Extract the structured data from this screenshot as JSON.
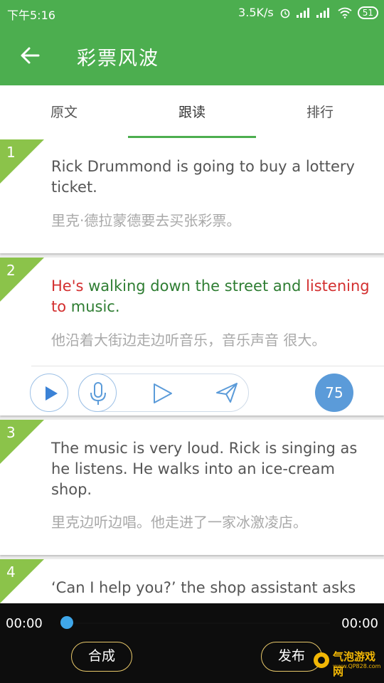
{
  "status": {
    "time": "下午5:16",
    "speed": "3.5K/s",
    "battery": "51"
  },
  "header": {
    "title": "彩票风波"
  },
  "tabs": [
    {
      "label": "原文"
    },
    {
      "label": "跟读"
    },
    {
      "label": "排行"
    }
  ],
  "active_tab": "跟读",
  "sentences": [
    {
      "num": "1",
      "en": "Rick Drummond is going to buy a lottery ticket.",
      "zh": "里克·德拉蒙德要去买张彩票。"
    },
    {
      "num": "2",
      "en_parts": [
        {
          "text": "He's ",
          "tone": "red"
        },
        {
          "text": "walking down the street and ",
          "tone": "green"
        },
        {
          "text": "listening ",
          "tone": "red"
        },
        {
          "text": "to ",
          "tone": "red"
        },
        {
          "text": "music.",
          "tone": "green"
        }
      ],
      "zh": "他沿着大街边走边听音乐，音乐声音 很大。",
      "score": "75"
    },
    {
      "num": "3",
      "en": "The music is very loud. Rick is singing as he listens. He walks into an ice-cream shop.",
      "zh": "里克边听边唱。他走进了一家冰激凌店。"
    },
    {
      "num": "4",
      "en": "‘Can I help you?’ the shop assistant asks"
    }
  ],
  "colors": {
    "primary": "#4cae4f",
    "score": "#5b9bd9",
    "word_good": "#2e7d32",
    "word_bad": "#d32f2f"
  },
  "player": {
    "current": "00:00",
    "total": "00:00",
    "progress": 0,
    "btn_compose": "合成",
    "btn_publish": "发布"
  },
  "watermark": {
    "text": "气泡游戏网",
    "sub": "www.QP828.com"
  },
  "icons": [
    "back-arrow-icon",
    "play-icon",
    "microphone-icon",
    "play-outline-icon",
    "send-icon",
    "alarm-icon",
    "signal-icon",
    "wifi-icon"
  ]
}
